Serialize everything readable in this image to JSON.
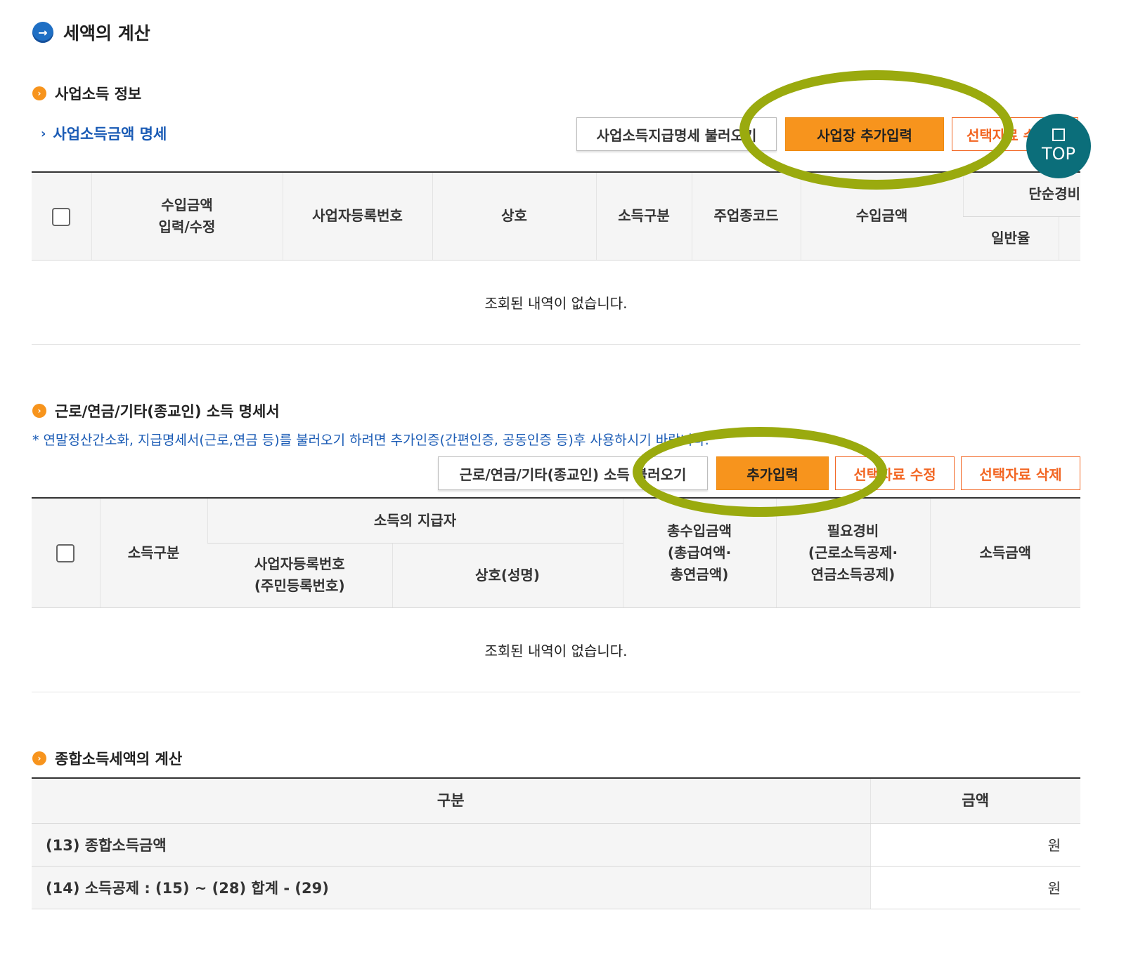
{
  "page_title": "세액의 계산",
  "business": {
    "title": "사업소득 정보",
    "sub_link": "사업소득금액 명세",
    "buttons": {
      "load": "사업소득지급명세 불러오기",
      "add": "사업장 추가입력",
      "modify": "선택자료 수정"
    },
    "columns": {
      "income_edit": "수입금액 입력/수정",
      "reg_no": "사업자등록번호",
      "trade_name": "상호",
      "income_type": "소득구분",
      "industry_code": "주업종코드",
      "revenue": "수입금액",
      "simple_expense": "단순경비",
      "general_rate": "일반율"
    },
    "empty": "조회된 내역이 없습니다."
  },
  "labor": {
    "title": "근로/연금/기타(종교인) 소득 명세서",
    "note": "* 연말정산간소화, 지급명세서(근로,연금 등)를 불러오기 하려면 추가인증(간편인증, 공동인증 등)후 사용하시기 바랍니다.",
    "buttons": {
      "load": "근로/연금/기타(종교인) 소득 불러오기",
      "add": "추가입력",
      "modify": "선택자료 수정",
      "delete": "선택자료 삭제"
    },
    "columns": {
      "income_type": "소득구분",
      "payer": "소득의 지급자",
      "reg_no_1": "사업자등록번호",
      "reg_no_2": "(주민등록번호)",
      "name": "상호(성명)",
      "total_1": "총수입금액",
      "total_2": "(총급여액·",
      "total_3": "총연금액)",
      "exp_1": "필요경비",
      "exp_2": "(근로소득공제·",
      "exp_3": "연금소득공제)",
      "amount": "소득금액"
    },
    "empty": "조회된 내역이 없습니다."
  },
  "calc": {
    "title": "종합소득세액의 계산",
    "col_category": "구분",
    "col_amount": "금액",
    "rows": [
      {
        "label": "(13) 종합소득금액",
        "unit": "원"
      },
      {
        "label": "(14) 소득공제 : (15) ~ (28) 합계 - (29)",
        "unit": "원"
      }
    ]
  },
  "top_button": "TOP",
  "colors": {
    "accent_orange": "#f7941d",
    "link_blue": "#1a5bb5",
    "highlight_ring": "#9aaa0e",
    "top_teal": "#0b6e7a"
  }
}
